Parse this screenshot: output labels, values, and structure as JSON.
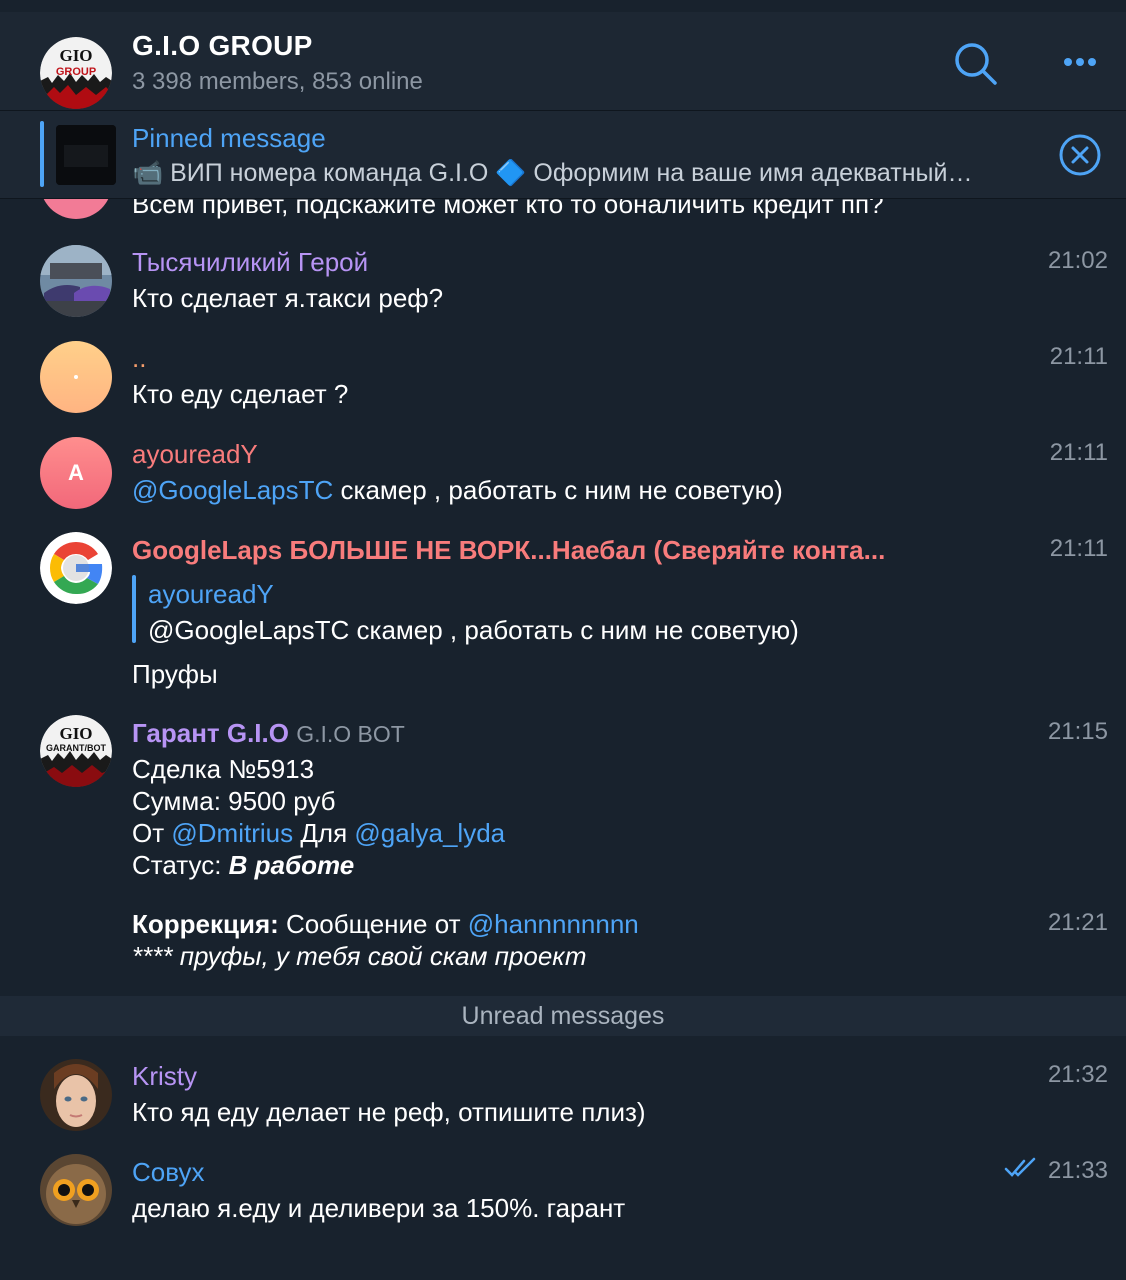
{
  "header": {
    "title": "G.I.O GROUP",
    "subtitle": "3 398 members, 853 online",
    "avatar_text_top": "GIO",
    "avatar_text_bottom": "GROUP"
  },
  "pinned": {
    "title": "Pinned message",
    "text": "📹 ВИП номера команда G.I.O 🔷 Оформим на ваше имя адекватный…"
  },
  "partial_message": {
    "text": "Всем привет, подскажите может кто то обналичить кредит пп?"
  },
  "messages": [
    {
      "name": "Тысячиликий Герой",
      "name_color": "#b794f4",
      "text": "Кто сделает я.такси реф?",
      "time": "21:02"
    },
    {
      "name": "..",
      "name_color": "#f59e6c",
      "text": "Кто еду сделает ?",
      "time": "21:11"
    },
    {
      "name": "ayoureadY",
      "name_color": "#f87c7c",
      "avatar_letter": "A",
      "mention": "@GoogleLapsTC",
      "text": " скамер , работать с ним не советую)",
      "time": "21:11"
    },
    {
      "name": "GoogleLaps БОЛЬШЕ НЕ ВОРК...Наебал (Сверяйте конта...",
      "name_color": "#f87c7c",
      "reply_name": "ayoureadY",
      "reply_text": "@GoogleLapsTC скамер , работать с ним не советую)",
      "text": "Пруфы",
      "time": "21:11"
    },
    {
      "name": "Гарант G.I.O",
      "name_color": "#b794f4",
      "badge": "G.I.O BOT",
      "avatar_text_top": "GIO",
      "avatar_text_bottom": "GARANT/BOT",
      "line1": "Сделка №5913",
      "line2": "Сумма: 9500 руб",
      "line3_from": "От ",
      "line3_mention1": "@Dmitrius",
      "line3_for": " Для ",
      "line3_mention2": "@galya_lyda",
      "line4_label": "Статус: ",
      "line4_value": "В работе",
      "time": "21:15",
      "corr_label": "Коррекция:",
      "corr_text": " Сообщение от ",
      "corr_mention": "@hannnnnnnn",
      "corr_line2": "**** пруфы, у тебя свой скам проект",
      "corr_time": "21:21"
    },
    {
      "name": "Kristy",
      "name_color": "#b794f4",
      "text": "Кто яд еду делает не реф, отпишите плиз)",
      "time": "21:32"
    },
    {
      "name": "Совух",
      "name_color": "#4ea4f6",
      "text": "делаю я.еду и деливери за 150%. гарант",
      "time": "21:33",
      "status": "read"
    }
  ],
  "unread_label": "Unread messages",
  "colors": {
    "accent": "#4ea4f6",
    "background": "#18222d",
    "header": "#1d2733",
    "secondary_text": "#8d97a3"
  },
  "icons": [
    "search-icon",
    "more-icon",
    "close-circle-icon",
    "double-check-icon",
    "camera-icon",
    "diamond-icon"
  ]
}
